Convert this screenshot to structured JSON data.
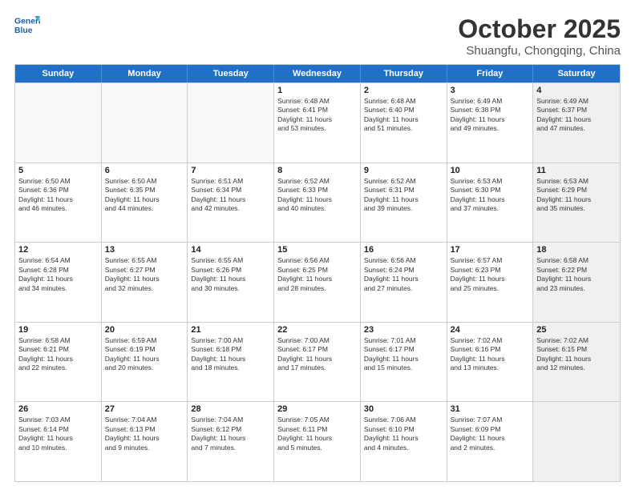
{
  "logo": {
    "line1": "General",
    "line2": "Blue"
  },
  "title": "October 2025",
  "location": "Shuangfu, Chongqing, China",
  "weekdays": [
    "Sunday",
    "Monday",
    "Tuesday",
    "Wednesday",
    "Thursday",
    "Friday",
    "Saturday"
  ],
  "rows": [
    [
      {
        "day": "",
        "text": "",
        "empty": true
      },
      {
        "day": "",
        "text": "",
        "empty": true
      },
      {
        "day": "",
        "text": "",
        "empty": true
      },
      {
        "day": "1",
        "text": "Sunrise: 6:48 AM\nSunset: 6:41 PM\nDaylight: 11 hours\nand 53 minutes."
      },
      {
        "day": "2",
        "text": "Sunrise: 6:48 AM\nSunset: 6:40 PM\nDaylight: 11 hours\nand 51 minutes."
      },
      {
        "day": "3",
        "text": "Sunrise: 6:49 AM\nSunset: 6:38 PM\nDaylight: 11 hours\nand 49 minutes."
      },
      {
        "day": "4",
        "text": "Sunrise: 6:49 AM\nSunset: 6:37 PM\nDaylight: 11 hours\nand 47 minutes.",
        "shaded": true
      }
    ],
    [
      {
        "day": "5",
        "text": "Sunrise: 6:50 AM\nSunset: 6:36 PM\nDaylight: 11 hours\nand 46 minutes."
      },
      {
        "day": "6",
        "text": "Sunrise: 6:50 AM\nSunset: 6:35 PM\nDaylight: 11 hours\nand 44 minutes."
      },
      {
        "day": "7",
        "text": "Sunrise: 6:51 AM\nSunset: 6:34 PM\nDaylight: 11 hours\nand 42 minutes."
      },
      {
        "day": "8",
        "text": "Sunrise: 6:52 AM\nSunset: 6:33 PM\nDaylight: 11 hours\nand 40 minutes."
      },
      {
        "day": "9",
        "text": "Sunrise: 6:52 AM\nSunset: 6:31 PM\nDaylight: 11 hours\nand 39 minutes."
      },
      {
        "day": "10",
        "text": "Sunrise: 6:53 AM\nSunset: 6:30 PM\nDaylight: 11 hours\nand 37 minutes."
      },
      {
        "day": "11",
        "text": "Sunrise: 6:53 AM\nSunset: 6:29 PM\nDaylight: 11 hours\nand 35 minutes.",
        "shaded": true
      }
    ],
    [
      {
        "day": "12",
        "text": "Sunrise: 6:54 AM\nSunset: 6:28 PM\nDaylight: 11 hours\nand 34 minutes."
      },
      {
        "day": "13",
        "text": "Sunrise: 6:55 AM\nSunset: 6:27 PM\nDaylight: 11 hours\nand 32 minutes."
      },
      {
        "day": "14",
        "text": "Sunrise: 6:55 AM\nSunset: 6:26 PM\nDaylight: 11 hours\nand 30 minutes."
      },
      {
        "day": "15",
        "text": "Sunrise: 6:56 AM\nSunset: 6:25 PM\nDaylight: 11 hours\nand 28 minutes."
      },
      {
        "day": "16",
        "text": "Sunrise: 6:56 AM\nSunset: 6:24 PM\nDaylight: 11 hours\nand 27 minutes."
      },
      {
        "day": "17",
        "text": "Sunrise: 6:57 AM\nSunset: 6:23 PM\nDaylight: 11 hours\nand 25 minutes."
      },
      {
        "day": "18",
        "text": "Sunrise: 6:58 AM\nSunset: 6:22 PM\nDaylight: 11 hours\nand 23 minutes.",
        "shaded": true
      }
    ],
    [
      {
        "day": "19",
        "text": "Sunrise: 6:58 AM\nSunset: 6:21 PM\nDaylight: 11 hours\nand 22 minutes."
      },
      {
        "day": "20",
        "text": "Sunrise: 6:59 AM\nSunset: 6:19 PM\nDaylight: 11 hours\nand 20 minutes."
      },
      {
        "day": "21",
        "text": "Sunrise: 7:00 AM\nSunset: 6:18 PM\nDaylight: 11 hours\nand 18 minutes."
      },
      {
        "day": "22",
        "text": "Sunrise: 7:00 AM\nSunset: 6:17 PM\nDaylight: 11 hours\nand 17 minutes."
      },
      {
        "day": "23",
        "text": "Sunrise: 7:01 AM\nSunset: 6:17 PM\nDaylight: 11 hours\nand 15 minutes."
      },
      {
        "day": "24",
        "text": "Sunrise: 7:02 AM\nSunset: 6:16 PM\nDaylight: 11 hours\nand 13 minutes."
      },
      {
        "day": "25",
        "text": "Sunrise: 7:02 AM\nSunset: 6:15 PM\nDaylight: 11 hours\nand 12 minutes.",
        "shaded": true
      }
    ],
    [
      {
        "day": "26",
        "text": "Sunrise: 7:03 AM\nSunset: 6:14 PM\nDaylight: 11 hours\nand 10 minutes."
      },
      {
        "day": "27",
        "text": "Sunrise: 7:04 AM\nSunset: 6:13 PM\nDaylight: 11 hours\nand 9 minutes."
      },
      {
        "day": "28",
        "text": "Sunrise: 7:04 AM\nSunset: 6:12 PM\nDaylight: 11 hours\nand 7 minutes."
      },
      {
        "day": "29",
        "text": "Sunrise: 7:05 AM\nSunset: 6:11 PM\nDaylight: 11 hours\nand 5 minutes."
      },
      {
        "day": "30",
        "text": "Sunrise: 7:06 AM\nSunset: 6:10 PM\nDaylight: 11 hours\nand 4 minutes."
      },
      {
        "day": "31",
        "text": "Sunrise: 7:07 AM\nSunset: 6:09 PM\nDaylight: 11 hours\nand 2 minutes."
      },
      {
        "day": "",
        "text": "",
        "empty": true,
        "shaded": true
      }
    ]
  ]
}
